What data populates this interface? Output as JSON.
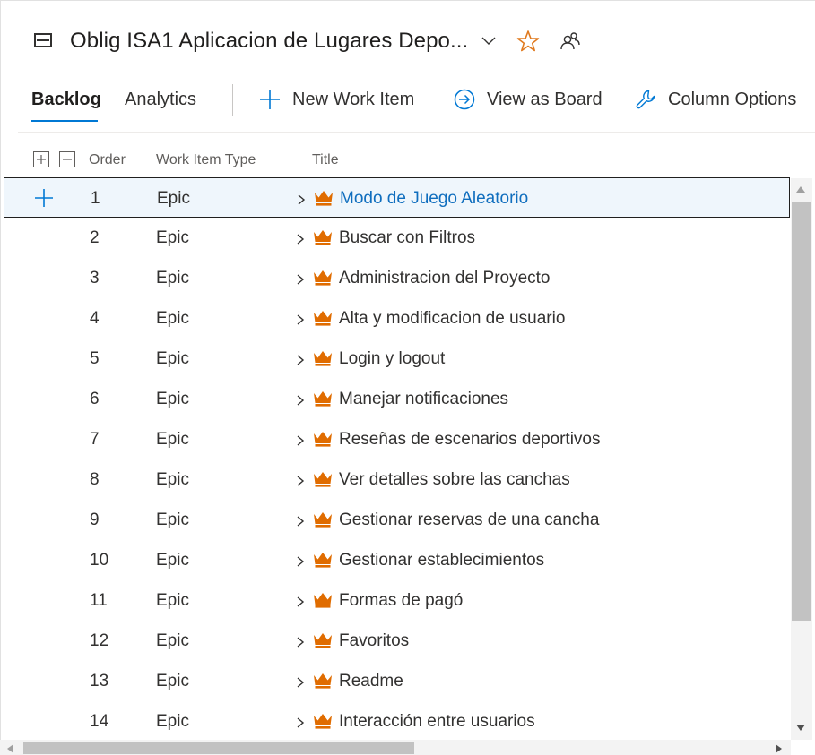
{
  "header": {
    "title": "Oblig ISA1 Aplicacion de Lugares Depo...",
    "icons": [
      "backlog-icon",
      "chevron-down-icon",
      "favorite-star-icon",
      "team-members-icon"
    ]
  },
  "tabs": [
    {
      "label": "Backlog",
      "selected": true
    },
    {
      "label": "Analytics",
      "selected": false
    }
  ],
  "toolbar": {
    "new_work_item": "New Work Item",
    "view_as_board": "View as Board",
    "column_options": "Column Options"
  },
  "grid": {
    "columns": [
      "Order",
      "Work Item Type",
      "Title"
    ],
    "rows": [
      {
        "order": "1",
        "type": "Epic",
        "title": "Modo de Juego Aleatorio",
        "selected": true
      },
      {
        "order": "2",
        "type": "Epic",
        "title": "Buscar con Filtros"
      },
      {
        "order": "3",
        "type": "Epic",
        "title": "Administracion del Proyecto"
      },
      {
        "order": "4",
        "type": "Epic",
        "title": "Alta y modificacion de usuario"
      },
      {
        "order": "5",
        "type": "Epic",
        "title": "Login y logout"
      },
      {
        "order": "6",
        "type": "Epic",
        "title": "Manejar notificaciones"
      },
      {
        "order": "7",
        "type": "Epic",
        "title": "Reseñas de escenarios deportivos"
      },
      {
        "order": "8",
        "type": "Epic",
        "title": "Ver detalles sobre las canchas"
      },
      {
        "order": "9",
        "type": "Epic",
        "title": "Gestionar reservas de una cancha"
      },
      {
        "order": "10",
        "type": "Epic",
        "title": "Gestionar establecimientos"
      },
      {
        "order": "11",
        "type": "Epic",
        "title": "Formas de pagó"
      },
      {
        "order": "12",
        "type": "Epic",
        "title": "Favoritos"
      },
      {
        "order": "13",
        "type": "Epic",
        "title": "Readme"
      },
      {
        "order": "14",
        "type": "Epic",
        "title": "Interacción entre usuarios"
      }
    ]
  },
  "colors": {
    "accent": "#0078d4",
    "epic": "#e06c00",
    "star": "#e07a1f",
    "selected_row": "#eff6fc"
  }
}
